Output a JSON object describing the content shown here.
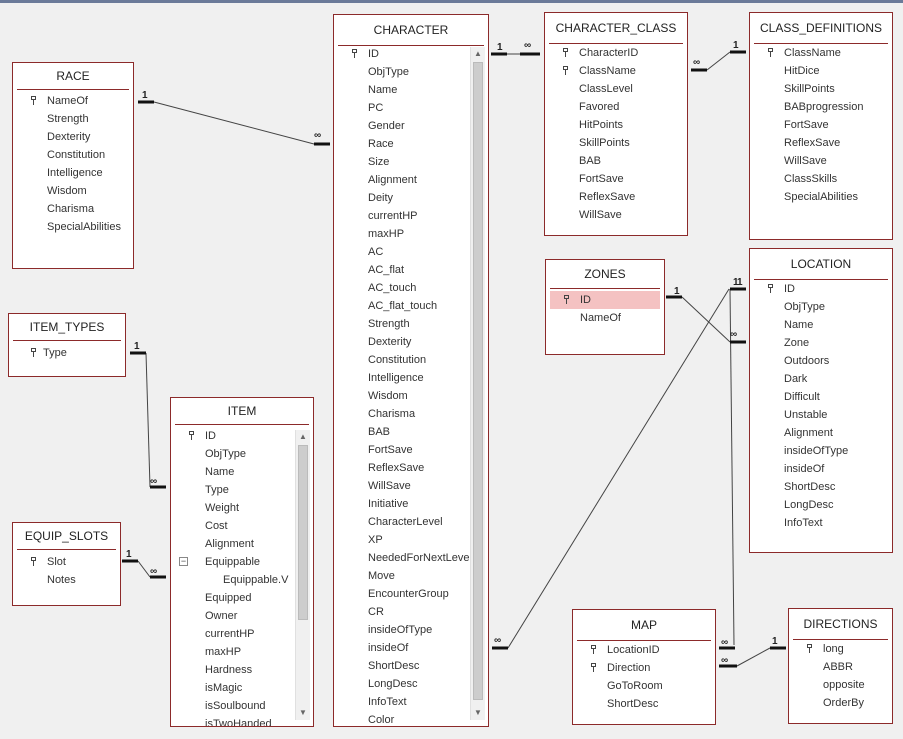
{
  "tables": {
    "race": {
      "title": "RACE",
      "fields": [
        "NameOf",
        "Strength",
        "Dexterity",
        "Constitution",
        "Intelligence",
        "Wisdom",
        "Charisma",
        "SpecialAbilities"
      ]
    },
    "item_types": {
      "title": "ITEM_TYPES",
      "fields": [
        "Type"
      ]
    },
    "equip_slots": {
      "title": "EQUIP_SLOTS",
      "fields": [
        "Slot",
        "Notes"
      ]
    },
    "item": {
      "title": "ITEM",
      "fields": [
        "ID",
        "ObjType",
        "Name",
        "Type",
        "Weight",
        "Cost",
        "Alignment",
        "Equippable",
        "Equippable.V",
        "Equipped",
        "Owner",
        "currentHP",
        "maxHP",
        "Hardness",
        "isMagic",
        "isSoulbound",
        "isTwoHanded"
      ]
    },
    "character": {
      "title": "CHARACTER",
      "fields": [
        "ID",
        "ObjType",
        "Name",
        "PC",
        "Gender",
        "Race",
        "Size",
        "Alignment",
        "Deity",
        "currentHP",
        "maxHP",
        "AC",
        "AC_flat",
        "AC_touch",
        "AC_flat_touch",
        "Strength",
        "Dexterity",
        "Constitution",
        "Intelligence",
        "Wisdom",
        "Charisma",
        "BAB",
        "FortSave",
        "ReflexSave",
        "WillSave",
        "Initiative",
        "CharacterLevel",
        "XP",
        "NeededForNextLevel",
        "Move",
        "EncounterGroup",
        "CR",
        "insideOfType",
        "insideOf",
        "ShortDesc",
        "LongDesc",
        "InfoText",
        "Color"
      ]
    },
    "character_class": {
      "title": "CHARACTER_CLASS",
      "fields": [
        "CharacterID",
        "ClassName",
        "ClassLevel",
        "Favored",
        "HitPoints",
        "SkillPoints",
        "BAB",
        "FortSave",
        "ReflexSave",
        "WillSave"
      ]
    },
    "class_definitions": {
      "title": "CLASS_DEFINITIONS",
      "fields": [
        "ClassName",
        "HitDice",
        "SkillPoints",
        "BABprogression",
        "FortSave",
        "ReflexSave",
        "WillSave",
        "ClassSkills",
        "SpecialAbilities"
      ]
    },
    "zones": {
      "title": "ZONES",
      "fields": [
        "ID",
        "NameOf"
      ]
    },
    "location": {
      "title": "LOCATION",
      "fields": [
        "ID",
        "ObjType",
        "Name",
        "Zone",
        "Outdoors",
        "Dark",
        "Difficult",
        "Unstable",
        "Alignment",
        "insideOfType",
        "insideOf",
        "ShortDesc",
        "LongDesc",
        "InfoText"
      ]
    },
    "map": {
      "title": "MAP",
      "fields": [
        "LocationID",
        "Direction",
        "GoToRoom",
        "ShortDesc"
      ]
    },
    "directions": {
      "title": "DIRECTIONS",
      "fields": [
        "long",
        "ABBR",
        "opposite",
        "OrderBy"
      ]
    }
  },
  "cardinality": {
    "one": "1",
    "many": "∞"
  },
  "colors": {
    "border": "#8c2a2a",
    "selected": "#f4c2c2",
    "background": "#f0f0f0"
  }
}
